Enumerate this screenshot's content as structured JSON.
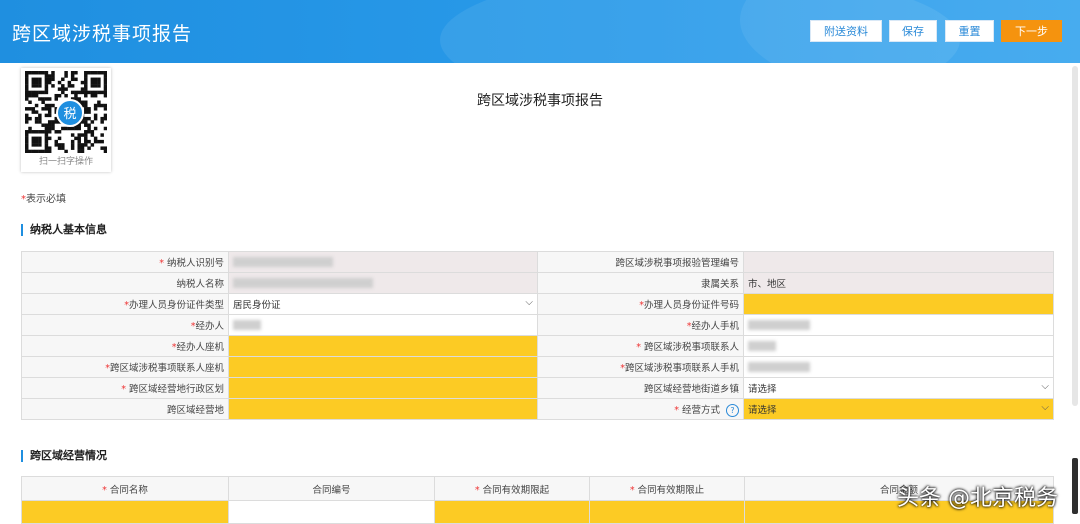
{
  "header": {
    "title": "跨区域涉税事项报告",
    "buttons": [
      "附送资料",
      "保存",
      "重置",
      "下一步"
    ]
  },
  "qr": {
    "caption": "扫一扫字操作",
    "badge": "税"
  },
  "doc_title": "跨区域涉税事项报告",
  "required_note": {
    "star": "*",
    "text": "表示必填"
  },
  "sections": {
    "basic": "纳税人基本信息",
    "operation": "跨区域经营情况"
  },
  "form": {
    "taxpayer_id": {
      "label": "纳税人识别号",
      "value": ""
    },
    "cross_mgmt_no": {
      "label": "跨区域涉税事项报验管理编号",
      "value": ""
    },
    "taxpayer_name": {
      "label": "纳税人名称",
      "value": ""
    },
    "affiliation": {
      "label": "隶属关系",
      "value": "市、地区"
    },
    "id_type": {
      "label": "办理人员身份证件类型",
      "value": "居民身份证"
    },
    "id_no": {
      "label": "办理人员身份证件号码",
      "value": ""
    },
    "handler": {
      "label": "经办人",
      "value": ""
    },
    "handler_mobile": {
      "label": "经办人手机",
      "value": ""
    },
    "handler_phone": {
      "label": "经办人座机",
      "value": ""
    },
    "contact": {
      "label": "跨区域涉税事项联系人",
      "value": ""
    },
    "contact_phone": {
      "label": "跨区域涉税事项联系人座机",
      "value": ""
    },
    "contact_mobile": {
      "label": "跨区域涉税事项联系人手机",
      "value": ""
    },
    "region": {
      "label": "跨区域经营地行政区划",
      "value": ""
    },
    "street": {
      "label": "跨区域经营地街道乡镇",
      "value": "请选择"
    },
    "place": {
      "label": "跨区域经营地",
      "value": ""
    },
    "mode": {
      "label": "经营方式",
      "value": "请选择"
    }
  },
  "contract_headers": [
    "合同名称",
    "合同编号",
    "合同有效期限起",
    "合同有效期限止",
    "合同金额"
  ],
  "watermark": "头条 @北京税务",
  "colors": {
    "header": "#1f8fe0",
    "primary": "#f5930e",
    "required_field": "#fccb24",
    "star": "#e33333"
  }
}
